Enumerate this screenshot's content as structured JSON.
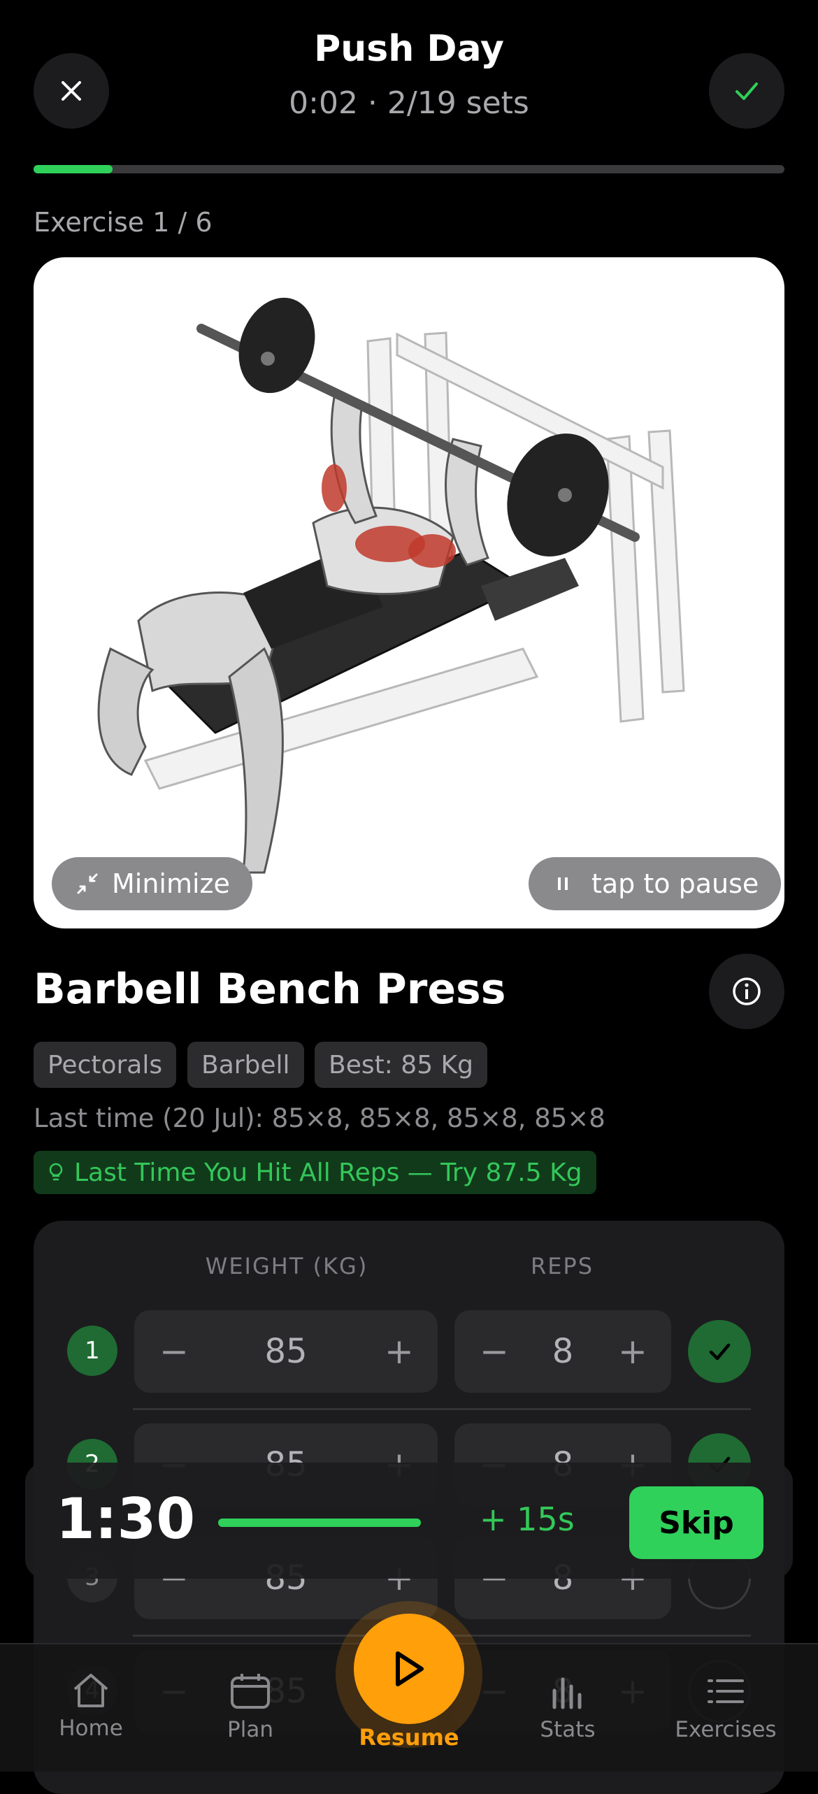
{
  "header": {
    "title": "Push Day",
    "subtitle": "0:02 · 2/19 sets",
    "progress_fraction": 0.105
  },
  "exercise_counter": "Exercise 1 / 6",
  "media": {
    "minimize_label": "Minimize",
    "pause_label": "tap to pause"
  },
  "exercise": {
    "name": "Barbell Bench Press",
    "tags": [
      "Pectorals",
      "Barbell",
      "Best: 85 Kg"
    ],
    "last_time": "Last time (20 Jul): 85×8, 85×8, 85×8, 85×8",
    "hint": "Last Time You Hit All Reps — Try 87.5 Kg"
  },
  "sets_table": {
    "weight_header": "WEIGHT (KG)",
    "reps_header": "REPS",
    "rows": [
      {
        "num": "1",
        "weight": "85",
        "reps": "8",
        "done": true
      },
      {
        "num": "2",
        "weight": "85",
        "reps": "8",
        "done": true
      },
      {
        "num": "3",
        "weight": "85",
        "reps": "8",
        "done": false
      },
      {
        "num": "4",
        "weight": "85",
        "reps": "8",
        "done": false
      }
    ]
  },
  "rest_timer": {
    "time": "1:30",
    "add_label": "+ 15s",
    "skip_label": "Skip"
  },
  "tabbar": {
    "home": "Home",
    "plan": "Plan",
    "resume": "Resume",
    "stats": "Stats",
    "exercises": "Exercises"
  },
  "colors": {
    "accent_green": "#2fd15a",
    "accent_orange": "#ff9f0a",
    "background": "#000000"
  }
}
